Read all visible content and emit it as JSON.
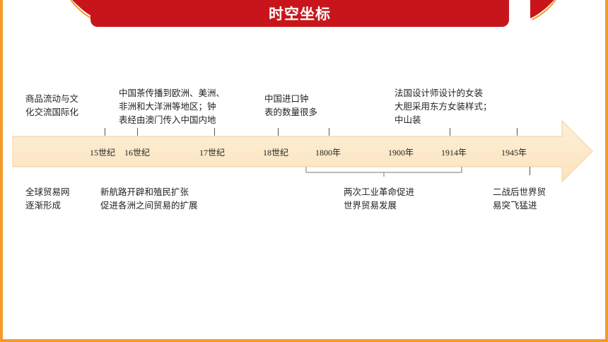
{
  "header": {
    "title": "时空坐标"
  },
  "colors": {
    "accent": "#c8151b",
    "frame": "#f39a2b",
    "arrow_fill": "#fdeacb"
  },
  "timeline_labels": [
    "15世纪",
    "16世纪",
    "17世纪",
    "18世纪",
    "1800年",
    "1900年",
    "1914年",
    "1945年"
  ],
  "notes_above": [
    [
      "商品流动与文",
      "化交流国际化"
    ],
    [
      "中国茶传播到欧洲、美洲、",
      "非洲和大洋洲等地区；钟",
      "表经由澳门传入中国内地"
    ],
    [
      "中国进口钟",
      "表的数量很多"
    ],
    [
      "法国设计师设计的女装",
      "大胆采用东方女装样式；",
      "中山装"
    ]
  ],
  "notes_below": [
    [
      "全球贸易网",
      "逐渐形成"
    ],
    [
      "新航路开辟和殖民扩张",
      "促进各洲之间贸易的扩展"
    ],
    [
      "两次工业革命促进",
      "世界贸易发展"
    ],
    [
      "二战后世界贸",
      "易突飞猛进"
    ]
  ]
}
